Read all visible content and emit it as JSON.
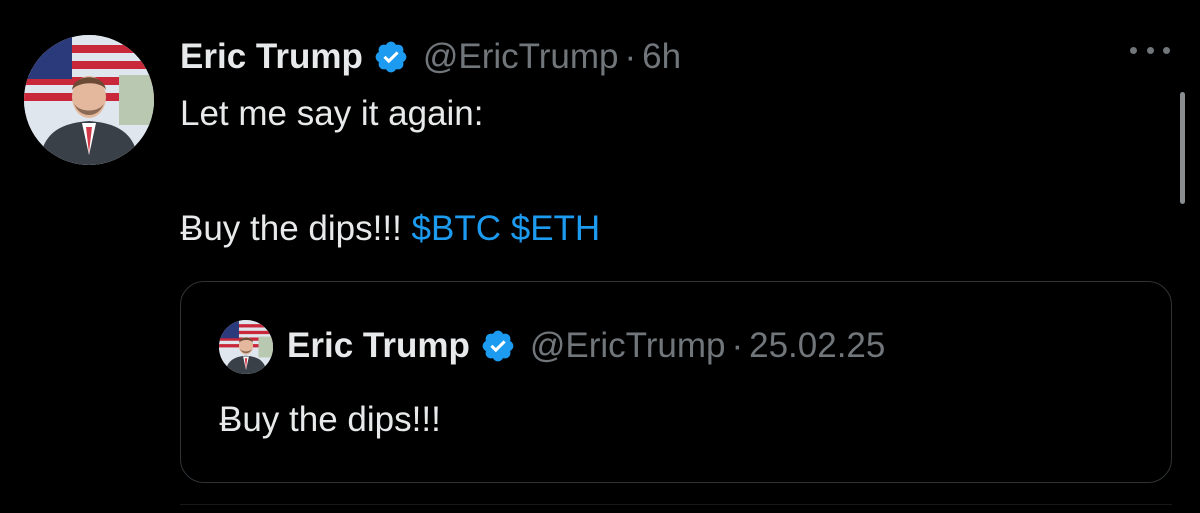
{
  "tweet": {
    "author_name": "Eric Trump",
    "author_handle": "@EricTrump",
    "separator": "·",
    "time": "6h",
    "text_line1": "Let me say it again:",
    "text_line2_prefix": "Ƀuy the dips!!!",
    "cashtags": [
      "$BTC",
      "$ETH"
    ]
  },
  "quoted_tweet": {
    "author_name": "Eric Trump",
    "author_handle": "@EricTrump",
    "separator": "·",
    "date": "25.02.25",
    "text": "Ƀuy the dips!!!"
  },
  "icons": {
    "verified": "verified-badge-icon",
    "more": "more-options-icon"
  },
  "colors": {
    "background": "#000000",
    "primary_text": "#e7e9ea",
    "secondary_text": "#71767b",
    "link": "#1d9bf0",
    "verified": "#1d9bf0",
    "border": "#2f3336"
  }
}
